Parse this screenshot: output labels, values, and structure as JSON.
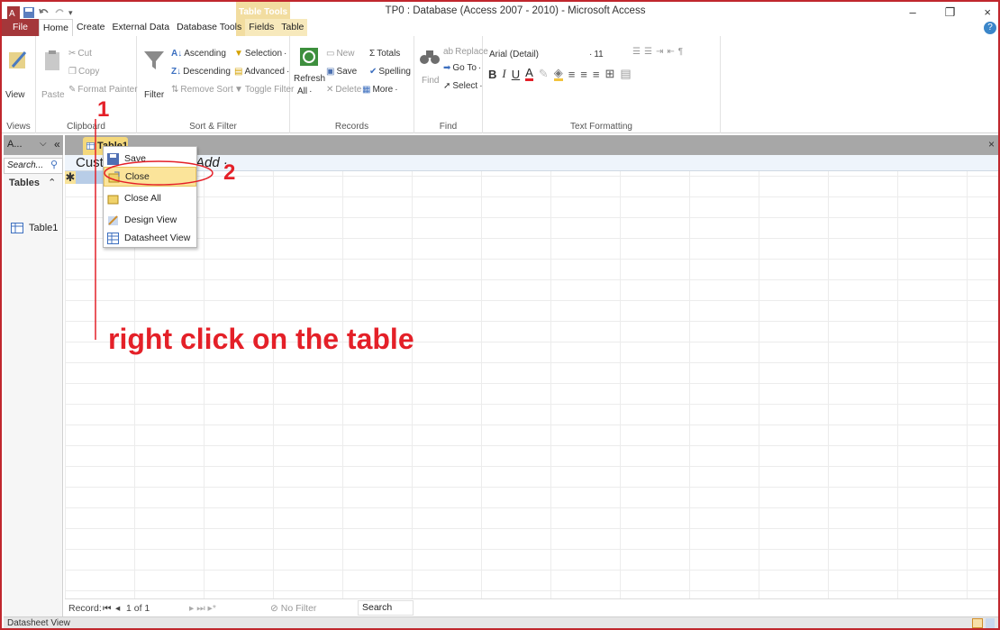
{
  "window": {
    "title": "TP0 : Database (Access 2007 - 2010) - Microsoft Access",
    "context_tab_group": "Table Tools",
    "controls": [
      "–",
      "❐",
      "×"
    ]
  },
  "tabs": [
    {
      "label": "File"
    },
    {
      "label": "Home"
    },
    {
      "label": "Create"
    },
    {
      "label": "External Data"
    },
    {
      "label": "Database Tools"
    },
    {
      "label": "Fields"
    },
    {
      "label": "Table"
    }
  ],
  "ribbon": {
    "views": {
      "view": "View",
      "group": "Views"
    },
    "clipboard": {
      "paste": "Paste",
      "cut": "Cut",
      "copy": "Copy",
      "format_painter": "Format Painter",
      "group": "Clipboard"
    },
    "sort_filter": {
      "filter": "Filter",
      "ascending": "Ascending",
      "descending": "Descending",
      "remove_sort": "Remove Sort",
      "selection": "Selection",
      "advanced": "Advanced",
      "toggle_filter": "Toggle Filter",
      "group": "Sort & Filter"
    },
    "records": {
      "refresh": "Refresh",
      "all": "All",
      "new": "New",
      "save": "Save",
      "delete": "Delete",
      "totals": "Totals",
      "spelling": "Spelling",
      "more": "More",
      "group": "Records"
    },
    "find": {
      "find": "Find",
      "replace": "Replace",
      "goto": "Go To",
      "select": "Select",
      "group": "Find"
    },
    "text_formatting": {
      "font": "Arial (Detail)",
      "size": "11",
      "group": "Text Formatting"
    }
  },
  "nav": {
    "header": "A...",
    "search": "Search...",
    "section": "Tables",
    "items": [
      {
        "label": "Table1"
      }
    ]
  },
  "doc_tab": {
    "label": "Table1"
  },
  "datasheet": {
    "col1": "Cust",
    "add_col": "Add"
  },
  "context_menu": {
    "items": [
      {
        "label": "Save"
      },
      {
        "label": "Close"
      },
      {
        "label": "Close All"
      },
      {
        "label": "Design View"
      },
      {
        "label": "Datasheet View"
      }
    ]
  },
  "record_nav": {
    "label": "Record:",
    "position": "1 of 1",
    "filter": "No Filter",
    "search": "Search"
  },
  "status": {
    "text": "Datasheet View"
  },
  "annotations": {
    "step1": "1",
    "step2": "2",
    "instruction": "right click on the table"
  },
  "colors": {
    "file_tab": "#a4373a",
    "annotation": "#e42028",
    "context_tab": "#f2dda0",
    "highlight": "#fbe49a"
  }
}
